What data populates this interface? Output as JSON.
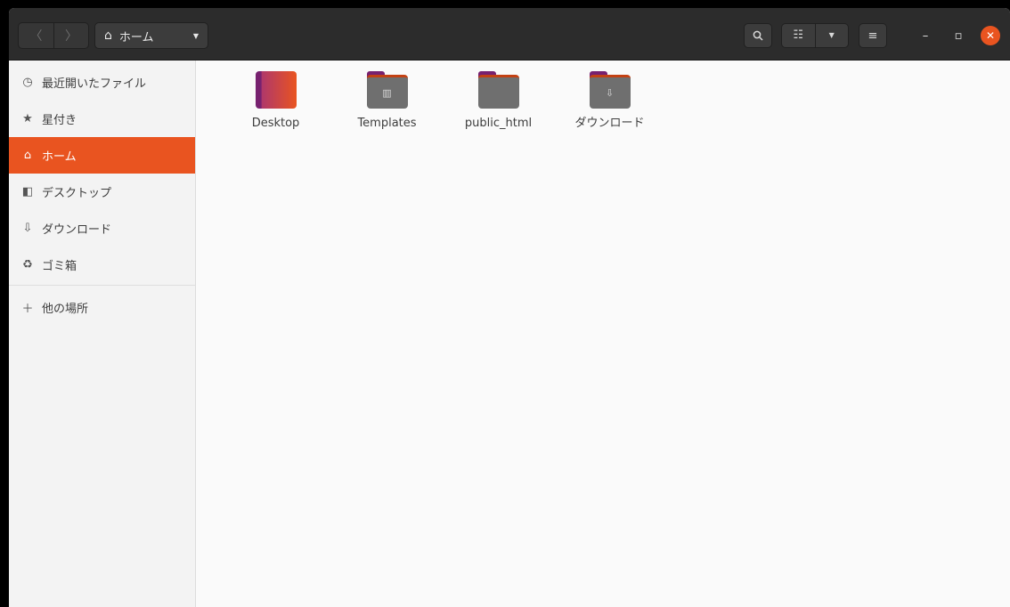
{
  "headerbar": {
    "back_icon": "chevron-left-icon",
    "forward_icon": "chevron-right-icon",
    "path_label": "ホーム",
    "path_icon": "home-icon",
    "search_icon": "search-icon",
    "view_icon": "list-view-icon",
    "menu_icon": "hamburger-menu-icon",
    "accent_color": "#e95420"
  },
  "sidebar": {
    "items": [
      {
        "label": "最近開いたファイル",
        "icon": "clock-icon"
      },
      {
        "label": "星付き",
        "icon": "star-icon"
      },
      {
        "label": "ホーム",
        "icon": "home-icon",
        "active": true
      },
      {
        "label": "デスクトップ",
        "icon": "desktop-icon"
      },
      {
        "label": "ダウンロード",
        "icon": "download-icon"
      },
      {
        "label": "ゴミ箱",
        "icon": "trash-icon"
      }
    ],
    "other_locations": {
      "label": "他の場所",
      "icon": "plus-icon"
    }
  },
  "files": [
    {
      "name": "Desktop",
      "icon": "desktop-folder-icon"
    },
    {
      "name": "Templates",
      "icon": "templates-folder-icon"
    },
    {
      "name": "public_html",
      "icon": "folder-icon"
    },
    {
      "name": "ダウンロード",
      "icon": "downloads-folder-icon"
    }
  ]
}
